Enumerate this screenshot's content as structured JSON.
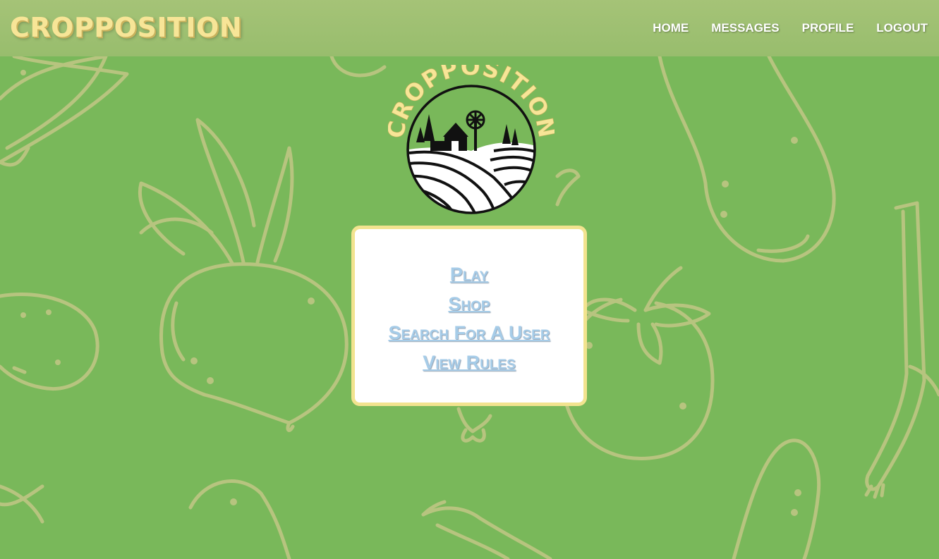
{
  "header": {
    "brand": "CROPPOSITION",
    "nav": [
      {
        "label": "HOME",
        "name": "nav-home"
      },
      {
        "label": "MESSAGES",
        "name": "nav-messages"
      },
      {
        "label": "PROFILE",
        "name": "nav-profile"
      },
      {
        "label": "LOGOUT",
        "name": "nav-logout"
      }
    ]
  },
  "logo": {
    "text": "CROPPOSITION"
  },
  "menu": {
    "items": [
      {
        "label": "Play"
      },
      {
        "label": "Shop"
      },
      {
        "label": "Search For A User"
      },
      {
        "label": "View Rules"
      }
    ]
  },
  "colors": {
    "background": "#79b85a",
    "navbar": "#a5c377",
    "brand": "#f7e597",
    "card_border": "#f2e38f",
    "menu_link": "#a6cce8",
    "doodle_stroke": "#b7c47f"
  },
  "icons": [
    "farm-logo-icon",
    "vegetable-doodle-background"
  ]
}
